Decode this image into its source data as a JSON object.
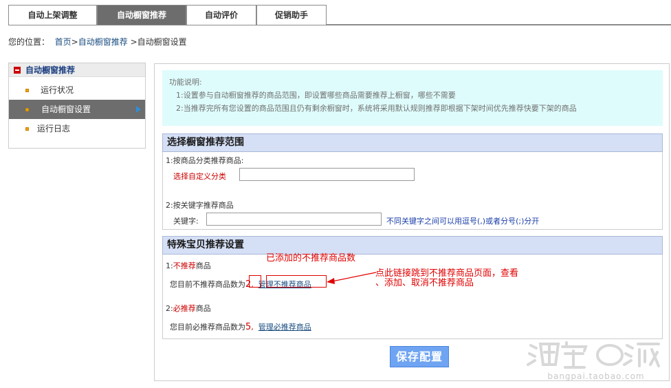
{
  "tabs": [
    {
      "label": "自动上架调整"
    },
    {
      "label": "自动橱窗推荐"
    },
    {
      "label": "自动评价"
    },
    {
      "label": "促销助手"
    }
  ],
  "breadcrumb": {
    "prefix": "您的位置：",
    "home": "首页",
    "sep1": ">",
    "section": "自动橱窗推荐",
    "sep2": ">",
    "current": "自动橱窗设置"
  },
  "sidebar": {
    "header": "自动橱窗推荐",
    "items": [
      {
        "label": "运行状况"
      },
      {
        "label": "自动橱窗设置"
      },
      {
        "label": "运行日志"
      }
    ]
  },
  "info": {
    "title": "功能说明:",
    "line1": "1:设置参与自动橱窗推荐的商品范围，即设置哪些商品需要推荐上橱窗，哪些不需要",
    "line2": "2:当推荐完所有您设置的商品范围且仍有剩余橱窗时，系统将采用默认规则推荐即根据下架时间优先推荐快要下架的商品"
  },
  "scope": {
    "title": "选择橱窗推荐范围",
    "by_category_label": "1:按商品分类推荐商品:",
    "custom_category_label": "选择自定义分类",
    "category_value": "",
    "by_keyword_label": "2:按关键字推荐商品",
    "keyword_label": "关键字:",
    "keyword_value": "",
    "keyword_hint": "不同关键字之间可以用逗号(,)或者分号(;)分开"
  },
  "special": {
    "title": "特殊宝贝推荐设置",
    "not_rec_prefix": "1:",
    "not_rec_red": "不推荐",
    "not_rec_suffix": "商品",
    "not_rec_count_text": "您目前不推荐商品数为",
    "not_rec_count": "2",
    "not_rec_comma": ",",
    "not_rec_link": "管理不推荐商品",
    "must_rec_prefix": "2:",
    "must_rec_red": "必推荐",
    "must_rec_suffix": "商品",
    "must_rec_count_text": "您目前必推荐商品数为",
    "must_rec_count": "5",
    "must_rec_comma": ",",
    "must_rec_link": "管理必推荐商品"
  },
  "annotations": {
    "added_count": "已添加的不推荐商品数",
    "link_note_line1": "点此链接跳到不推荐商品页面，查看",
    "link_note_line2": "、添加、取消不推荐商品"
  },
  "save_label": "保存配置",
  "watermark": {
    "domain": "bangpai.taobao.com"
  },
  "colors": {
    "active_tab": "#6d6d6d",
    "info_bg": "#dffcfc",
    "section_header_bg": "#d5dff5",
    "annotation_red": "#e00000",
    "save_button": "#6fa4f2"
  }
}
